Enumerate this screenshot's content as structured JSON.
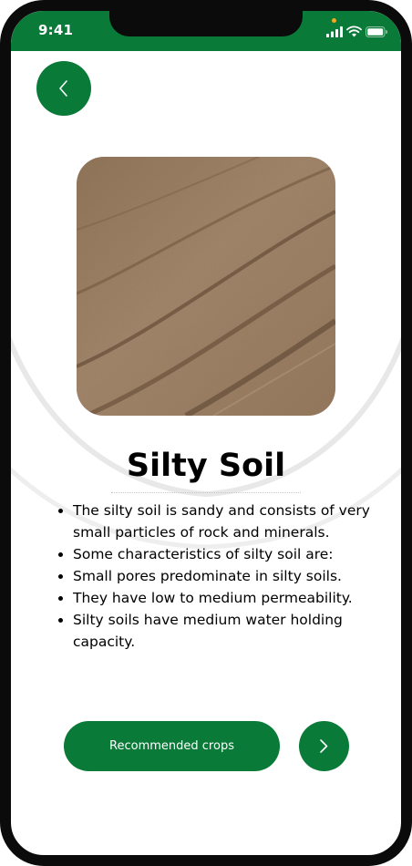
{
  "status_bar": {
    "time": "9:41",
    "icons": [
      "signal-icon",
      "wifi-icon",
      "battery-icon"
    ]
  },
  "header": {
    "back_icon": "chevron-left-icon"
  },
  "soil": {
    "image": "silty-soil-field-photo",
    "title": "Silty Soil",
    "facts": [
      "The silty soil is sandy and consists of very small particles of rock and minerals.",
      "Some characteristics of silty soil are:",
      "Small pores predominate in silty soils.",
      "They have low to medium permeability.",
      "Silty soils have medium water holding capacity."
    ]
  },
  "actions": {
    "recommended_label": "Recommended crops",
    "next_icon": "chevron-right-icon"
  },
  "colors": {
    "primary_green": "#0a7a38",
    "frame": "#0b0b0b",
    "text": "#000000"
  }
}
